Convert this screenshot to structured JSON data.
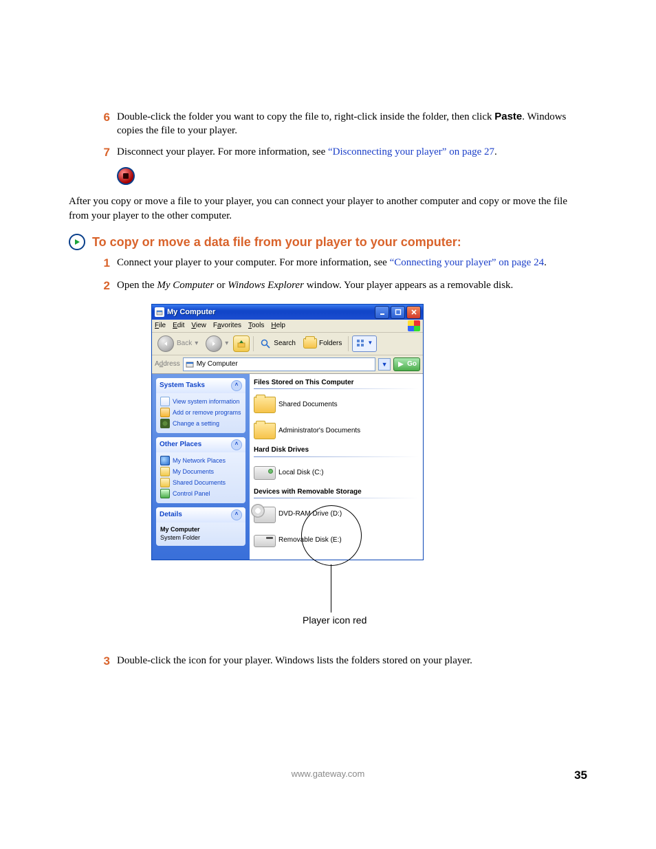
{
  "steps_a": {
    "6": {
      "num": "6",
      "text_before": "Double-click the folder you want to copy the file to, right-click inside the folder, then click ",
      "bold": "Paste",
      "text_after": ". Windows copies the file to your player."
    },
    "7": {
      "num": "7",
      "text_before": "Disconnect your player. For more information, see ",
      "link": "“Disconnecting your player” on page 27",
      "text_after": "."
    }
  },
  "paragraph": "After you copy or move a file to your player, you can connect your player to another computer and copy or move the file from your player to the other computer.",
  "heading": "To copy or move a data file from your player to your computer:",
  "steps_b": {
    "1": {
      "num": "1",
      "text_before": "Connect your player to your computer. For more information, see ",
      "link": "“Connecting your player” on page 24",
      "text_after": "."
    },
    "2": {
      "num": "2",
      "text_a": "Open the ",
      "italic1": "My Computer",
      "text_b": " or ",
      "italic2": "Windows Explorer",
      "text_c": " window. Your player appears as a removable disk."
    },
    "3": {
      "num": "3",
      "text": "Double-click the icon for your player. Windows lists the folders stored on your player."
    }
  },
  "callout": "Player icon red",
  "footer": {
    "url": "www.gateway.com",
    "page": "35"
  },
  "win": {
    "title": "My Computer",
    "menus": {
      "file": "File",
      "edit": "Edit",
      "view": "View",
      "favorites": "Favorites",
      "tools": "Tools",
      "help": "Help"
    },
    "toolbar": {
      "back": "Back",
      "search": "Search",
      "folders": "Folders"
    },
    "address": {
      "label": "Address",
      "value": "My Computer",
      "go": "Go"
    },
    "side": {
      "tasks": {
        "title": "System Tasks",
        "items": [
          "View system information",
          "Add or remove programs",
          "Change a setting"
        ]
      },
      "places": {
        "title": "Other Places",
        "items": [
          "My Network Places",
          "My Documents",
          "Shared Documents",
          "Control Panel"
        ]
      },
      "details": {
        "title": "Details",
        "line1": "My Computer",
        "line2": "System Folder"
      }
    },
    "groups": {
      "files": {
        "title": "Files Stored on This Computer",
        "items": [
          "Shared Documents",
          "Administrator's Documents"
        ]
      },
      "hdd": {
        "title": "Hard Disk Drives",
        "items": [
          "Local Disk (C:)"
        ]
      },
      "rem": {
        "title": "Devices with Removable Storage",
        "items": [
          "DVD-RAM Drive (D:)",
          "Removable Disk (E:)"
        ]
      }
    }
  }
}
